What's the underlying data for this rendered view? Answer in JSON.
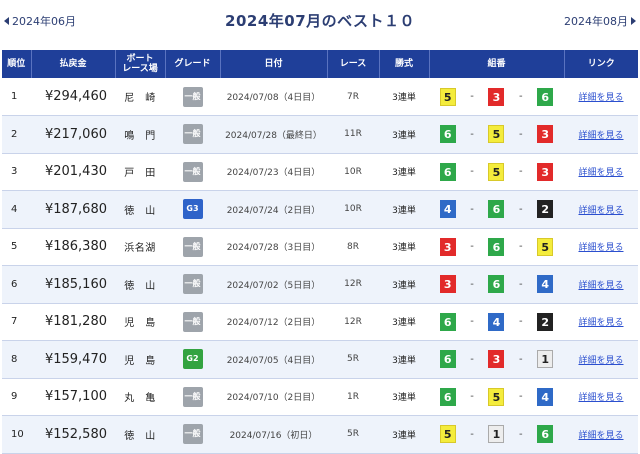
{
  "nav": {
    "prev": "2024年06月",
    "next": "2024年08月"
  },
  "title": "2024年07月のベスト１０",
  "headers": {
    "rank": "順位",
    "payout": "払戻金",
    "venue_l1": "ボート",
    "venue_l2": "レース場",
    "grade": "グレード",
    "date": "日付",
    "race": "レース",
    "type": "勝式",
    "combo": "組番",
    "link": "リンク"
  },
  "colors": {
    "header_bg": "#1f3f99",
    "accent_text": "#2c3e73",
    "link": "#2b4fcf",
    "boat_1": "#ededed",
    "boat_2": "#222222",
    "boat_3": "#e22a2a",
    "boat_4": "#2f6ac7",
    "boat_5": "#f4ec3c",
    "boat_6": "#2ea84a",
    "grade_ippan": "#9ea4ab",
    "grade_g3": "#2e63c9",
    "grade_g2": "#33a340"
  },
  "rows": [
    {
      "rank": "1",
      "payout": "¥294,460",
      "venue": "尼　崎",
      "grade": "一般",
      "grade_class": "ippan",
      "date": "2024/07/08（4日目）",
      "race": "7R",
      "type": "3連単",
      "combo": [
        "5",
        "3",
        "6"
      ],
      "link": "詳細を見る"
    },
    {
      "rank": "2",
      "payout": "¥217,060",
      "venue": "鳴　門",
      "grade": "一般",
      "grade_class": "ippan",
      "date": "2024/07/28（最終日）",
      "race": "11R",
      "type": "3連単",
      "combo": [
        "6",
        "5",
        "3"
      ],
      "link": "詳細を見る"
    },
    {
      "rank": "3",
      "payout": "¥201,430",
      "venue": "戸　田",
      "grade": "一般",
      "grade_class": "ippan",
      "date": "2024/07/23（4日目）",
      "race": "10R",
      "type": "3連単",
      "combo": [
        "6",
        "5",
        "3"
      ],
      "link": "詳細を見る"
    },
    {
      "rank": "4",
      "payout": "¥187,680",
      "venue": "徳　山",
      "grade": "G3",
      "grade_class": "g3",
      "date": "2024/07/24（2日目）",
      "race": "10R",
      "type": "3連単",
      "combo": [
        "4",
        "6",
        "2"
      ],
      "link": "詳細を見る"
    },
    {
      "rank": "5",
      "payout": "¥186,380",
      "venue": "浜名湖",
      "grade": "一般",
      "grade_class": "ippan",
      "date": "2024/07/28（3日目）",
      "race": "8R",
      "type": "3連単",
      "combo": [
        "3",
        "6",
        "5"
      ],
      "link": "詳細を見る"
    },
    {
      "rank": "6",
      "payout": "¥185,160",
      "venue": "徳　山",
      "grade": "一般",
      "grade_class": "ippan",
      "date": "2024/07/02（5日目）",
      "race": "12R",
      "type": "3連単",
      "combo": [
        "3",
        "6",
        "4"
      ],
      "link": "詳細を見る"
    },
    {
      "rank": "7",
      "payout": "¥181,280",
      "venue": "児　島",
      "grade": "一般",
      "grade_class": "ippan",
      "date": "2024/07/12（2日目）",
      "race": "12R",
      "type": "3連単",
      "combo": [
        "6",
        "4",
        "2"
      ],
      "link": "詳細を見る"
    },
    {
      "rank": "8",
      "payout": "¥159,470",
      "venue": "児　島",
      "grade": "G2",
      "grade_class": "g2",
      "date": "2024/07/05（4日目）",
      "race": "5R",
      "type": "3連単",
      "combo": [
        "6",
        "3",
        "1"
      ],
      "link": "詳細を見る"
    },
    {
      "rank": "9",
      "payout": "¥157,100",
      "venue": "丸　亀",
      "grade": "一般",
      "grade_class": "ippan",
      "date": "2024/07/10（2日目）",
      "race": "1R",
      "type": "3連単",
      "combo": [
        "6",
        "5",
        "4"
      ],
      "link": "詳細を見る"
    },
    {
      "rank": "10",
      "payout": "¥152,580",
      "venue": "徳　山",
      "grade": "一般",
      "grade_class": "ippan",
      "date": "2024/07/16（初日）",
      "race": "5R",
      "type": "3連単",
      "combo": [
        "5",
        "1",
        "6"
      ],
      "link": "詳細を見る"
    }
  ]
}
